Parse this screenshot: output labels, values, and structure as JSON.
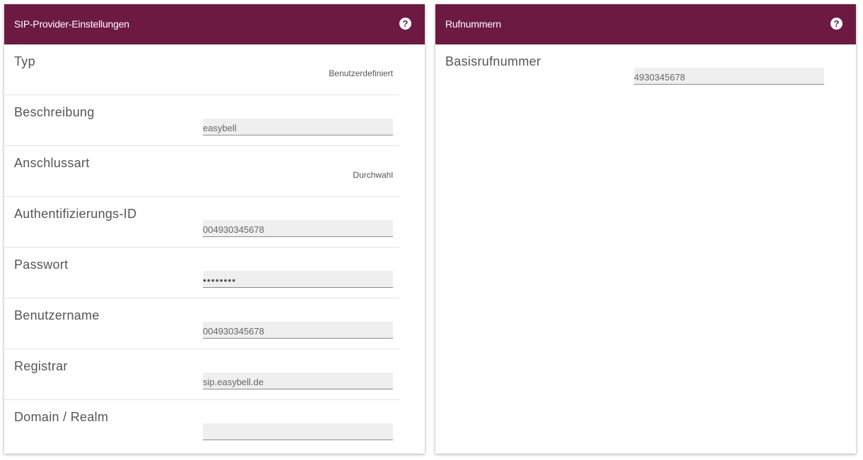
{
  "left_panel": {
    "title": "SIP-Provider-Einstellungen",
    "help_glyph": "?",
    "rows": [
      {
        "label": "Typ",
        "value": "Benutzerdefiniert"
      },
      {
        "label": "Beschreibung",
        "value": "easybell"
      },
      {
        "label": "Anschlussart",
        "value": "Durchwahl"
      },
      {
        "label": "Authentifizierungs-ID",
        "value": "004930345678"
      },
      {
        "label": "Passwort",
        "value": "••••••••"
      },
      {
        "label": "Benutzername",
        "value": "004930345678"
      },
      {
        "label": "Registrar",
        "value": "sip.easybell.de"
      },
      {
        "label": "Domain / Realm",
        "value": ""
      }
    ]
  },
  "right_panel": {
    "title": "Rufnummern",
    "help_glyph": "?",
    "rows": [
      {
        "label": "Basisrufnummer",
        "value": "4930345678"
      }
    ]
  },
  "colors": {
    "header_bg": "#6d1a43",
    "input_bg": "#efefef",
    "label_text": "#555555"
  },
  "icons": {
    "help": "help-icon"
  }
}
